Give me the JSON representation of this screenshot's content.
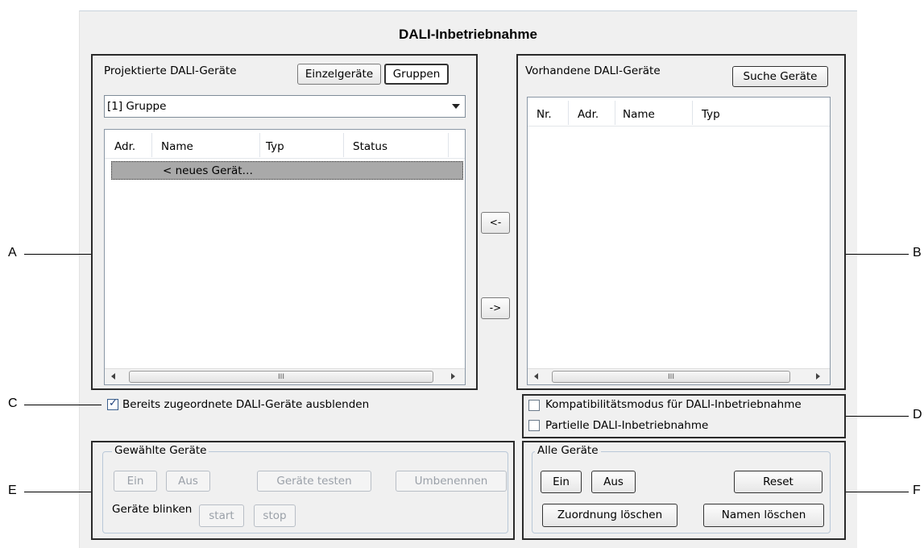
{
  "dialog": {
    "title": "DALI-Inbetriebnahme"
  },
  "projected": {
    "title": "Projektierte DALI-Geräte",
    "btn_single": "Einzelgeräte",
    "btn_groups": "Gruppen",
    "dropdown_value": "[1] Gruppe",
    "columns": [
      "Adr.",
      "Name",
      "Typ",
      "Status"
    ],
    "rows": [
      {
        "adr": "",
        "name": "< neues Gerät…",
        "typ": "",
        "status": ""
      }
    ],
    "scroll_grip": "III"
  },
  "transfer": {
    "left": "<-",
    "right": "->"
  },
  "existing": {
    "title": "Vorhandene DALI-Geräte",
    "btn_search": "Suche Geräte",
    "columns": [
      "Nr.",
      "Adr.",
      "Name",
      "Typ"
    ],
    "scroll_grip": "III"
  },
  "options": {
    "hide_assigned": {
      "label": "Bereits zugeordnete DALI-Geräte ausblenden",
      "checked": true
    },
    "compat_mode": {
      "label": "Kompatibilitätsmodus für DALI-Inbetriebnahme",
      "checked": false
    },
    "partial": {
      "label": "Partielle DALI-Inbetriebnahme",
      "checked": false
    }
  },
  "selected_devices": {
    "title": "Gewählte Geräte",
    "on": "Ein",
    "off": "Aus",
    "test": "Geräte testen",
    "rename": "Umbenennen",
    "blink_label": "Geräte blinken",
    "start": "start",
    "stop": "stop"
  },
  "all_devices": {
    "title": "Alle Geräte",
    "on": "Ein",
    "off": "Aus",
    "reset": "Reset",
    "clear_assignment": "Zuordnung löschen",
    "clear_names": "Namen löschen"
  },
  "callouts": {
    "a": "A",
    "b": "B",
    "c": "C",
    "d": "D",
    "e": "E",
    "f": "F"
  }
}
